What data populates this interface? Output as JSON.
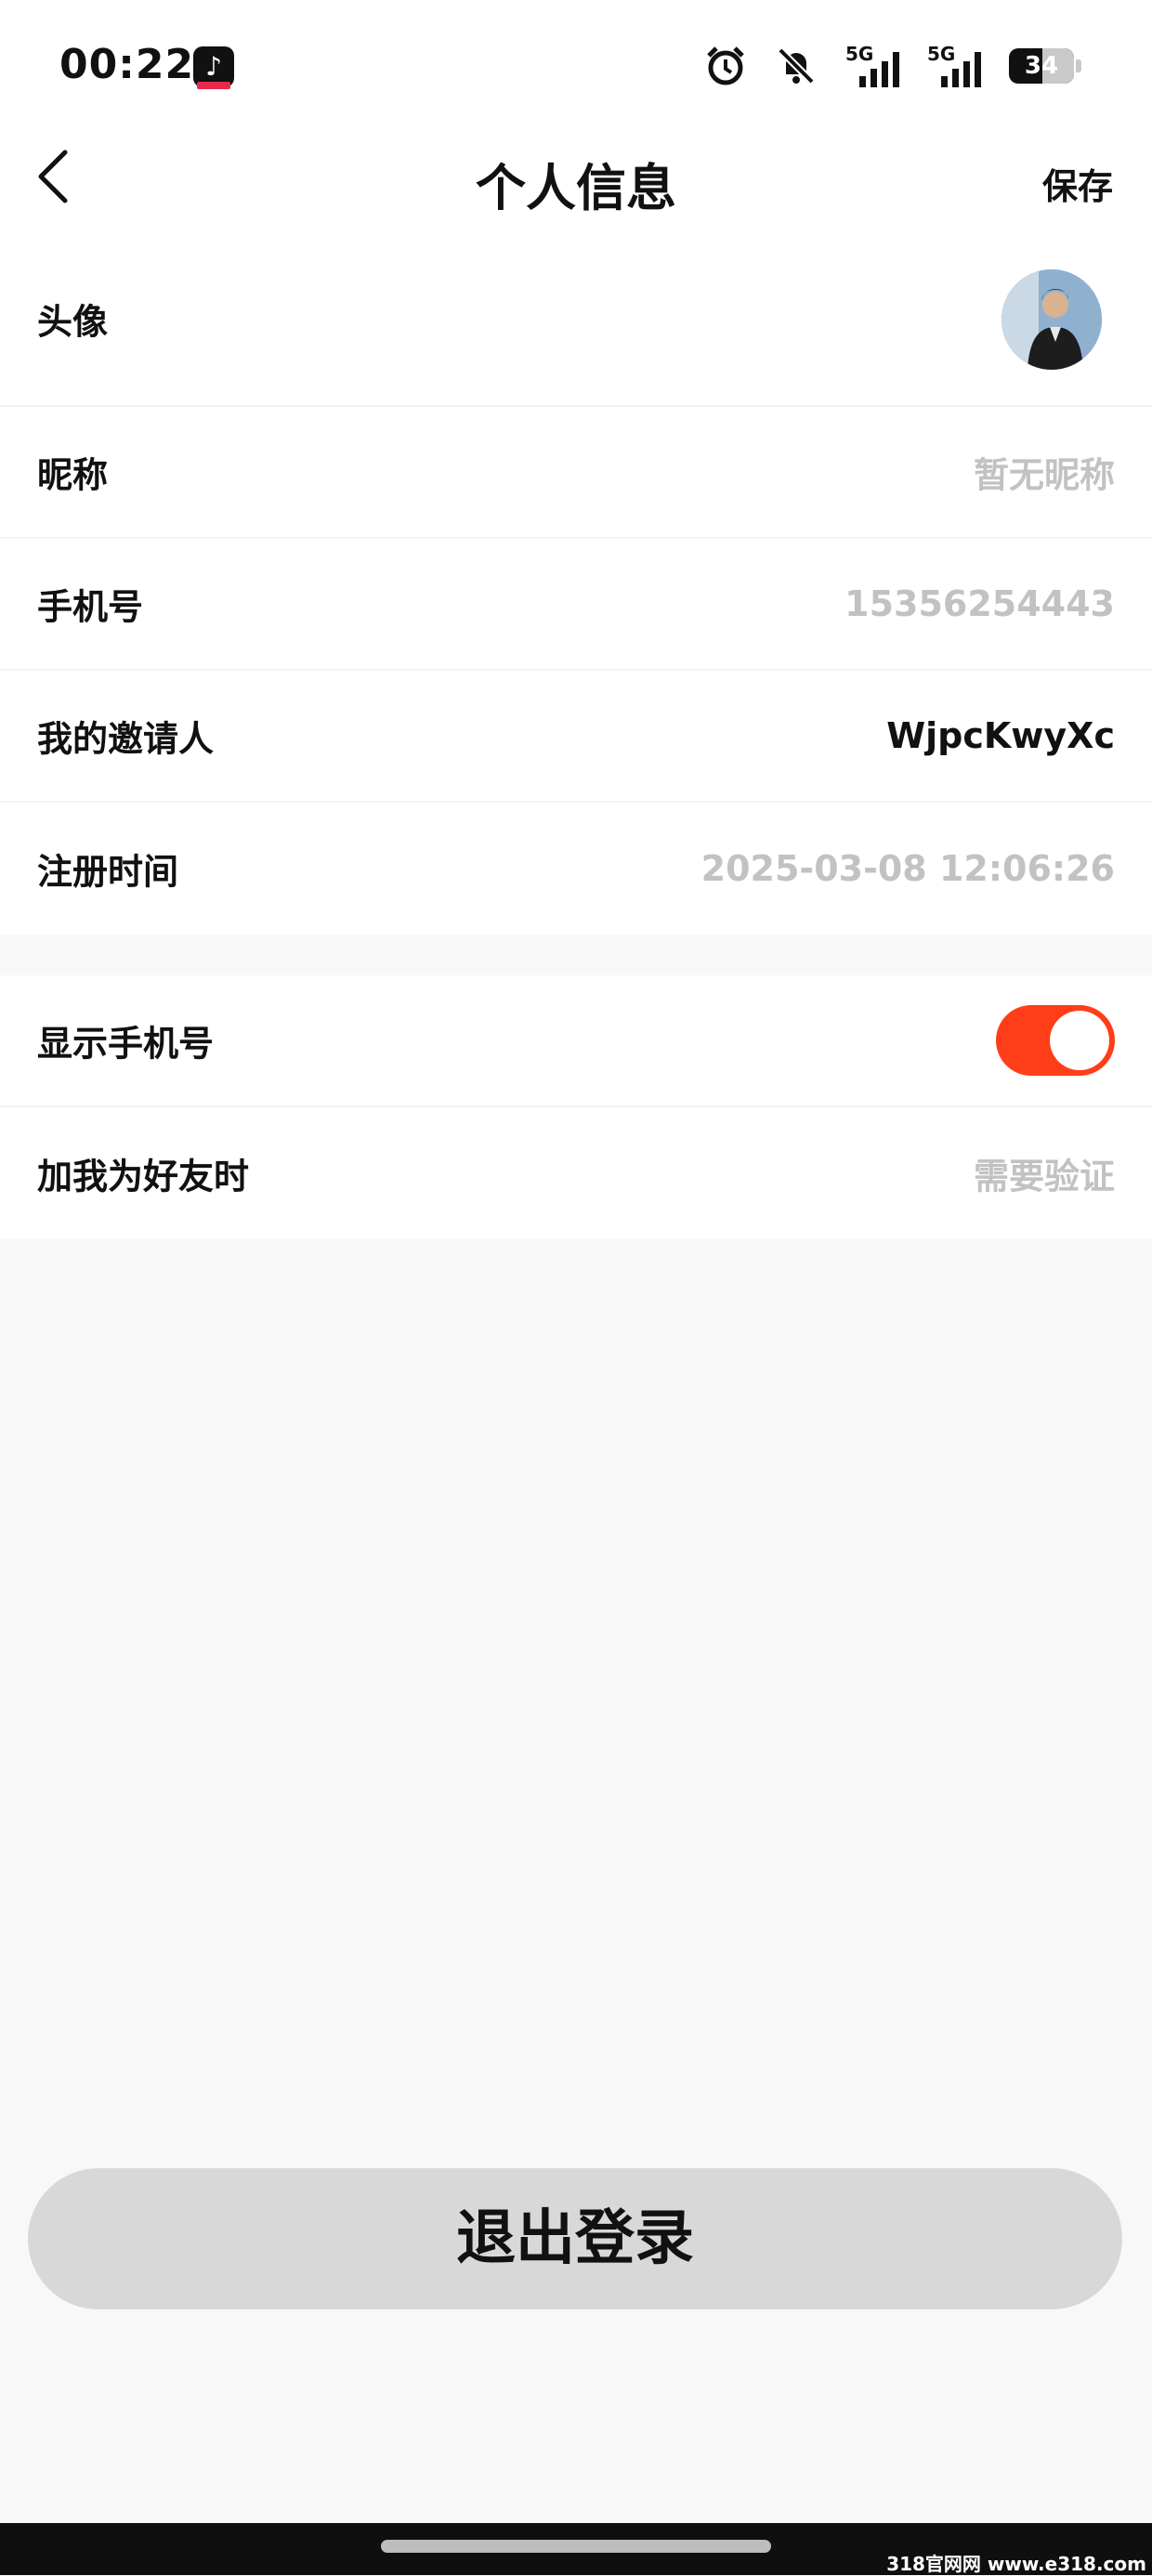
{
  "status_bar": {
    "time": "00:22",
    "icons": [
      "alarm-icon",
      "mute-bell-icon",
      "signal-5g-icon",
      "signal-5g-icon",
      "battery-icon"
    ],
    "network_1": "5G",
    "network_2": "5G",
    "battery_level": "34"
  },
  "header": {
    "title": "个人信息",
    "save_label": "保存"
  },
  "profile": {
    "avatar_label": "头像",
    "nickname_label": "昵称",
    "nickname_value": "暂无昵称",
    "phone_label": "手机号",
    "phone_value": "15356254443",
    "inviter_label": "我的邀请人",
    "inviter_value": "WjpcKwyXc",
    "register_label": "注册时间",
    "register_value": "2025-03-08 12:06:26"
  },
  "settings": {
    "show_phone_label": "显示手机号",
    "show_phone_on": true,
    "add_friend_label": "加我为好友时",
    "add_friend_value": "需要验证"
  },
  "logout_label": "退出登录",
  "watermark": "318官网网 www.e318.com",
  "colors": {
    "accent": "#ff3d18",
    "background": "#f8f8f8",
    "muted_text": "#c2c2c2"
  }
}
